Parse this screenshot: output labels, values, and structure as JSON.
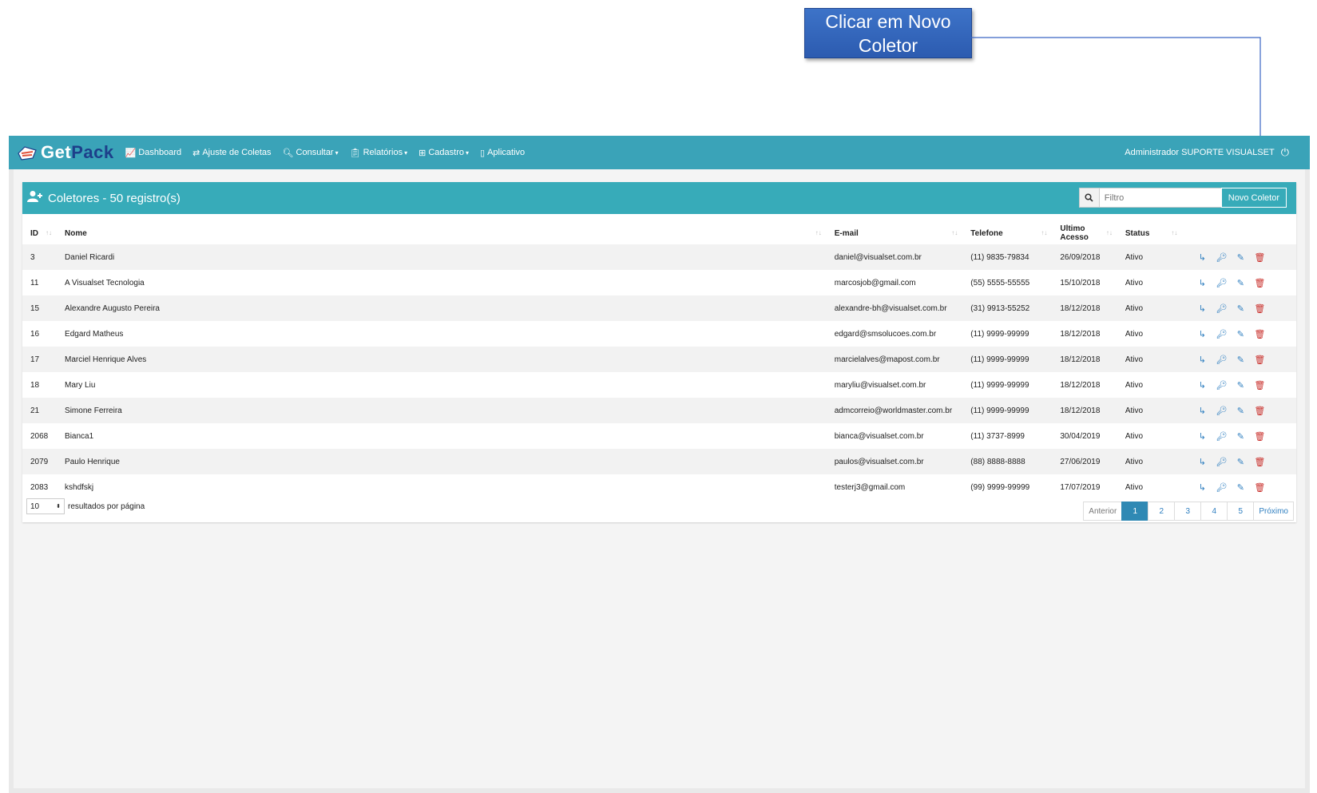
{
  "callout": {
    "text": "Clicar em Novo Coletor"
  },
  "navbar": {
    "logo_get": "Get",
    "logo_pack": "Pack",
    "items": [
      {
        "label": "Dashboard",
        "icon": "chart-icon",
        "dropdown": false
      },
      {
        "label": "Ajuste de Coletas",
        "icon": "exchange-icon",
        "dropdown": false
      },
      {
        "label": "Consultar",
        "icon": "search-icon",
        "dropdown": true
      },
      {
        "label": "Relatórios",
        "icon": "clipboard-icon",
        "dropdown": true
      },
      {
        "label": "Cadastro",
        "icon": "grid-icon",
        "dropdown": true
      },
      {
        "label": "Aplicativo",
        "icon": "mobile-icon",
        "dropdown": false
      }
    ],
    "user": "Administrador SUPORTE VISUALSET"
  },
  "panel": {
    "title": "Coletores - 50 registro(s)",
    "filter_placeholder": "Filtro",
    "new_button": "Novo Coletor"
  },
  "table": {
    "columns": [
      "ID",
      "Nome",
      "E-mail",
      "Telefone",
      "Ultimo Acesso",
      "Status"
    ],
    "rows": [
      {
        "id": "3",
        "nome": "Daniel Ricardi",
        "email": "daniel@visualset.com.br",
        "telefone": "(11) 9835-79834",
        "acesso": "26/09/2018",
        "status": "Ativo"
      },
      {
        "id": "11",
        "nome": "A Visualset Tecnologia",
        "email": "marcosjob@gmail.com",
        "telefone": "(55) 5555-55555",
        "acesso": "15/10/2018",
        "status": "Ativo"
      },
      {
        "id": "15",
        "nome": "Alexandre Augusto Pereira",
        "email": "alexandre-bh@visualset.com.br",
        "telefone": "(31) 9913-55252",
        "acesso": "18/12/2018",
        "status": "Ativo"
      },
      {
        "id": "16",
        "nome": "Edgard Matheus",
        "email": "edgard@smsolucoes.com.br",
        "telefone": "(11) 9999-99999",
        "acesso": "18/12/2018",
        "status": "Ativo"
      },
      {
        "id": "17",
        "nome": "Marciel Henrique Alves",
        "email": "marcielalves@mapost.com.br",
        "telefone": "(11) 9999-99999",
        "acesso": "18/12/2018",
        "status": "Ativo"
      },
      {
        "id": "18",
        "nome": "Mary Liu",
        "email": "maryliu@visualset.com.br",
        "telefone": "(11) 9999-99999",
        "acesso": "18/12/2018",
        "status": "Ativo"
      },
      {
        "id": "21",
        "nome": "Simone Ferreira",
        "email": "admcorreio@worldmaster.com.br",
        "telefone": "(11) 9999-99999",
        "acesso": "18/12/2018",
        "status": "Ativo"
      },
      {
        "id": "2068",
        "nome": "Bianca1",
        "email": "bianca@visualset.com.br",
        "telefone": "(11) 3737-8999",
        "acesso": "30/04/2019",
        "status": "Ativo"
      },
      {
        "id": "2079",
        "nome": "Paulo Henrique",
        "email": "paulos@visualset.com.br",
        "telefone": "(88) 8888-8888",
        "acesso": "27/06/2019",
        "status": "Ativo"
      },
      {
        "id": "2083",
        "nome": "kshdfskj",
        "email": "testerj3@gmail.com",
        "telefone": "(99) 9999-99999",
        "acesso": "17/07/2019",
        "status": "Ativo"
      }
    ]
  },
  "footer": {
    "page_length": "10",
    "page_length_label": "resultados por página",
    "prev": "Anterior",
    "pages": [
      "1",
      "2",
      "3",
      "4",
      "5"
    ],
    "active_page": "1",
    "next": "Próximo"
  },
  "colors": {
    "navbar": "#3aa3b8",
    "panel_header": "#37abb9",
    "callout": "#2c5bb0",
    "delete": "#c9302c",
    "action": "#2f7fc0"
  }
}
